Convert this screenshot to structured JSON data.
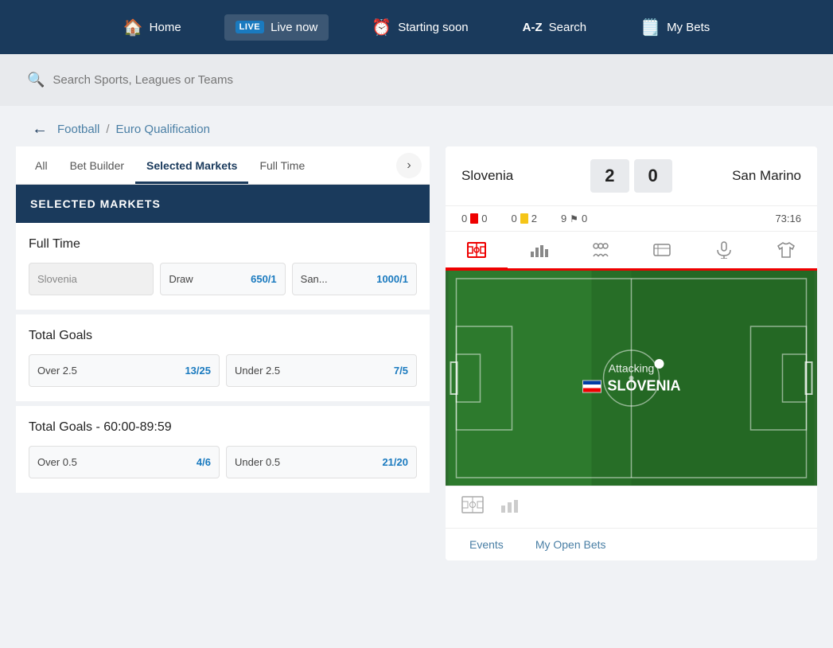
{
  "topNav": {
    "items": [
      {
        "id": "home",
        "label": "Home",
        "icon": "🏠",
        "badge": null
      },
      {
        "id": "live",
        "label": "Live now",
        "icon": null,
        "badge": "LIVE"
      },
      {
        "id": "starting-soon",
        "label": "Starting soon",
        "icon": "⏰",
        "badge": null
      },
      {
        "id": "search",
        "label": "Search",
        "icon": "A-Z",
        "badge": null
      },
      {
        "id": "my-bets",
        "label": "My Bets",
        "icon": "📋",
        "badge": null
      }
    ]
  },
  "searchBar": {
    "placeholder": "Search Sports, Leagues or Teams"
  },
  "breadcrumb": {
    "sport": "Football",
    "competition": "Euro Qualification"
  },
  "tabs": {
    "items": [
      {
        "id": "all",
        "label": "All"
      },
      {
        "id": "bet-builder",
        "label": "Bet Builder"
      },
      {
        "id": "selected-markets",
        "label": "Selected Markets"
      },
      {
        "id": "full-time",
        "label": "Full Time"
      }
    ],
    "active": "selected-markets"
  },
  "selectedMarketsHeader": "SELECTED MARKETS",
  "markets": [
    {
      "id": "full-time",
      "title": "Full Time",
      "odds": [
        {
          "label": "Slovenia",
          "value": null,
          "disabled": true
        },
        {
          "label": "Draw",
          "value": "650/1",
          "disabled": false
        },
        {
          "label": "San...",
          "value": "1000/1",
          "disabled": false
        }
      ]
    },
    {
      "id": "total-goals",
      "title": "Total Goals",
      "odds": [
        {
          "label": "Over 2.5",
          "value": "13/25",
          "disabled": false
        },
        {
          "label": "Under 2.5",
          "value": "7/5",
          "disabled": false
        }
      ]
    },
    {
      "id": "total-goals-60-89",
      "title": "Total Goals - 60:00-89:59",
      "odds": [
        {
          "label": "Over 0.5",
          "value": "4/6",
          "disabled": false
        },
        {
          "label": "Under 0.5",
          "value": "21/20",
          "disabled": false
        }
      ]
    }
  ],
  "match": {
    "homeTeam": "Slovenia",
    "awayTeam": "San Marino",
    "homeScore": "2",
    "awayScore": "0",
    "time": "73:16",
    "stats": {
      "home": {
        "redCards": "0",
        "rc": "0",
        "yellowCards": "0",
        "yc": "2",
        "corners": "9",
        "co": "0"
      },
      "away": {
        "redCards": "0",
        "rc": "0",
        "yellowCards": "0",
        "yc": "2",
        "corners": "9",
        "co": "0"
      }
    },
    "attacking": {
      "text": "Attacking",
      "team": "SLOVENIA"
    },
    "ballX": "57%",
    "ballY": "43%"
  },
  "bottomBar": {
    "events": "Events",
    "myOpenBets": "My Open Bets"
  }
}
